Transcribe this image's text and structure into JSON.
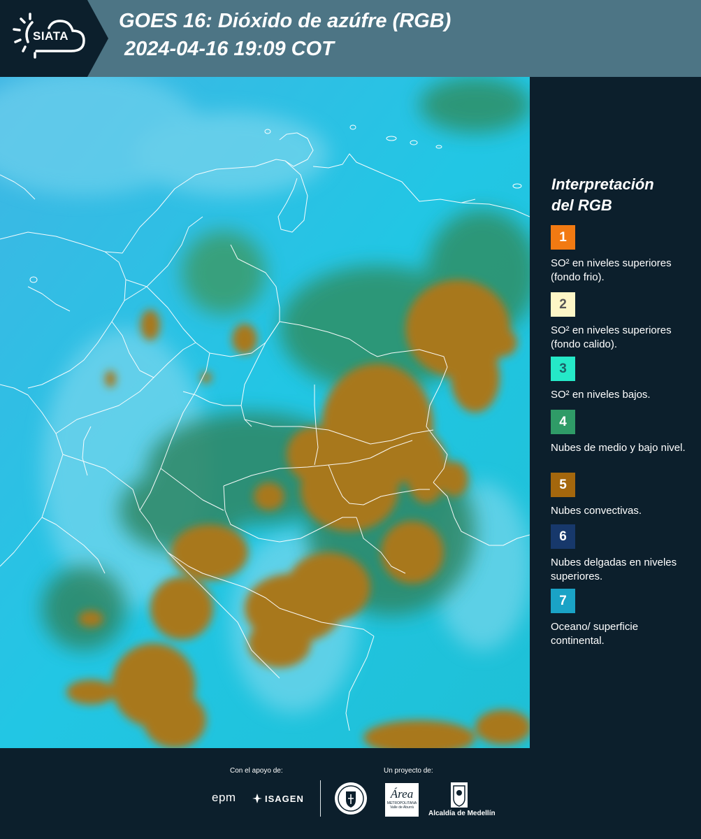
{
  "header": {
    "logo": "SIATA",
    "title_line1": "GOES 16: Dióxido de azúfre (RGB)",
    "title_line2": "2024-04-16 19:09 COT"
  },
  "legend": {
    "title_line1": "Interpretación",
    "title_line2": "del RGB",
    "items": [
      {
        "number": "1",
        "label": "SO² en niveles superiores (fondo frio).",
        "color": "#f27a12",
        "text_color": "#ffffff"
      },
      {
        "number": "2",
        "label": "SO² en niveles superiores (fondo calido).",
        "color": "#fdf6c6",
        "text_color": "#555555"
      },
      {
        "number": "3",
        "label": "SO² en niveles bajos.",
        "color": "#25e9c8",
        "text_color": "#1e5f66"
      },
      {
        "number": "4",
        "label": "Nubes de medio y bajo nivel.",
        "color": "#2f9b67",
        "text_color": "#ffffff"
      },
      {
        "number": "5",
        "label": "Nubes convectivas.",
        "color": "#a4670d",
        "text_color": "#ffffff"
      },
      {
        "number": "6",
        "label": "Nubes delgadas en niveles superiores.",
        "color": "#17386b",
        "text_color": "#ffffff"
      },
      {
        "number": "7",
        "label": "Oceano/ superficie continental.",
        "color": "#1aa3c6",
        "text_color": "#ffffff"
      }
    ]
  },
  "footer": {
    "support_label": "Con el apoyo de:",
    "project_label": "Un proyecto de:",
    "sponsors": [
      "epm",
      "ISAGEN"
    ],
    "partners": {
      "area_logo": "Área",
      "area_sub": "METROPOLITANA",
      "area_sub2": "Valle de Aburrá",
      "alcaldia": "Alcaldía de Medellín"
    }
  },
  "colors": {
    "background": "#0c1f2c",
    "header": "#4d7585",
    "ocean": "#22c6e4",
    "cloud_convective": "#a87a22",
    "cloud_low": "#2e8a63",
    "borders": "#ffffff"
  }
}
